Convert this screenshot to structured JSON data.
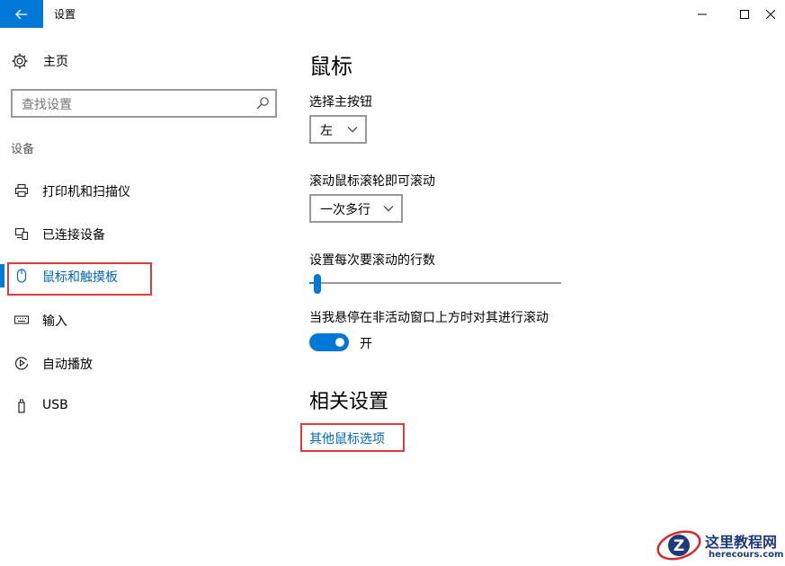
{
  "window": {
    "title": "设置"
  },
  "nav": {
    "home_label": "主页",
    "search_placeholder": "查找设置",
    "section_label": "设备",
    "items": [
      {
        "label": "打印机和扫描仪",
        "icon": "printer-icon"
      },
      {
        "label": "已连接设备",
        "icon": "connected-devices-icon"
      },
      {
        "label": "鼠标和触摸板",
        "icon": "mouse-icon",
        "selected": true
      },
      {
        "label": "输入",
        "icon": "keyboard-icon"
      },
      {
        "label": "自动播放",
        "icon": "autoplay-icon"
      },
      {
        "label": "USB",
        "icon": "usb-icon"
      }
    ]
  },
  "main": {
    "title": "鼠标",
    "primary_button": {
      "label": "选择主按钮",
      "value": "左"
    },
    "scroll_wheel": {
      "label": "滚动鼠标滚轮即可滚动",
      "value": "一次多行"
    },
    "scroll_lines": {
      "label": "设置每次要滚动的行数",
      "value_fraction": 0.02
    },
    "inactive_scroll": {
      "label": "当我悬停在非活动窗口上方时对其进行滚动",
      "state_label": "开",
      "on": true
    },
    "related": {
      "title": "相关设置",
      "link": "其他鼠标选项"
    }
  },
  "watermark": {
    "cn": "这里教程网",
    "en": "herecours.com"
  },
  "colors": {
    "accent": "#0078d7",
    "link": "#0067b8",
    "highlight_box": "#e23a3a",
    "watermark_text": "#1f3a7a"
  }
}
